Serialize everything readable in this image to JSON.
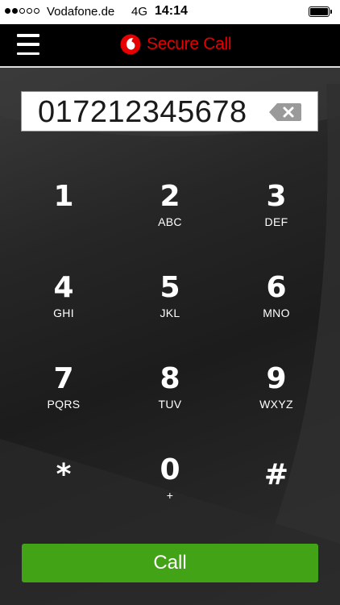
{
  "status_bar": {
    "carrier": "Vodafone.de",
    "network": "4G",
    "time": "14:14",
    "signal_bars_filled": 2,
    "signal_bars_total": 5
  },
  "header": {
    "title": "Secure Call",
    "brand_color": "#e60000"
  },
  "display": {
    "number": "017212345678"
  },
  "keypad": [
    {
      "digit": "1",
      "letters": ""
    },
    {
      "digit": "2",
      "letters": "ABC"
    },
    {
      "digit": "3",
      "letters": "DEF"
    },
    {
      "digit": "4",
      "letters": "GHI"
    },
    {
      "digit": "5",
      "letters": "JKL"
    },
    {
      "digit": "6",
      "letters": "MNO"
    },
    {
      "digit": "7",
      "letters": "PQRS"
    },
    {
      "digit": "8",
      "letters": "TUV"
    },
    {
      "digit": "9",
      "letters": "WXYZ"
    },
    {
      "digit": "*",
      "letters": ""
    },
    {
      "digit": "0",
      "letters": "+"
    },
    {
      "digit": "#",
      "letters": ""
    }
  ],
  "call_button": {
    "label": "Call",
    "color": "#43a317"
  },
  "icons": {
    "menu": "hamburger-menu-icon",
    "logo": "vodafone-logo-icon",
    "backspace": "backspace-icon",
    "battery": "battery-icon"
  }
}
